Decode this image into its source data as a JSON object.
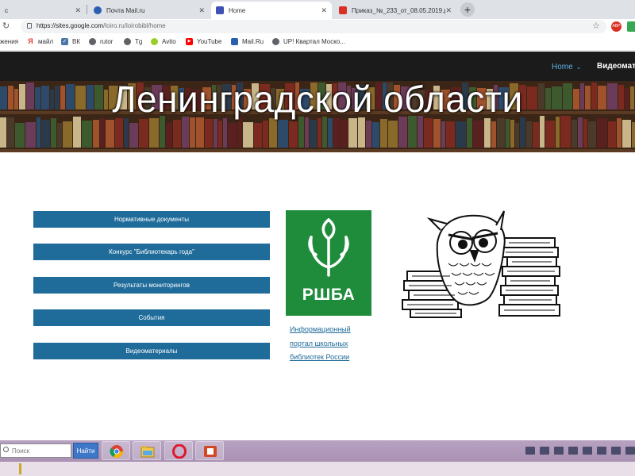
{
  "browser": {
    "tabs": [
      {
        "label": "c",
        "favicon_color": "#ffffff",
        "active": false
      },
      {
        "label": "Почта Mail.ru",
        "favicon_color": "#2a5fb0",
        "active": false
      },
      {
        "label": "Home",
        "favicon_color": "#3f51b5",
        "active": true
      },
      {
        "label": "Приказ_№_233_от_08.05.2019.p",
        "favicon_color": "#d93025",
        "active": false
      }
    ],
    "new_tab_label": "+",
    "address": {
      "host": "https://sites.google.com",
      "path": "/loiro.ru/loirobibl/home"
    },
    "bookmarks": [
      {
        "label": "жения",
        "icon": "none",
        "color": "#ffffff"
      },
      {
        "label": "майл",
        "icon": "yandex-icon",
        "glyph": "Я",
        "color": "#e53935"
      },
      {
        "label": "ВК",
        "icon": "vk-icon",
        "glyph": "В",
        "color": "#4a76a8"
      },
      {
        "label": "rutor",
        "icon": "globe-icon",
        "glyph": "",
        "color": "#5f6368"
      },
      {
        "label": "Tg",
        "icon": "globe-icon",
        "glyph": "",
        "color": "#5f6368"
      },
      {
        "label": "Avito",
        "icon": "avito-icon",
        "glyph": "",
        "color": "#97cf26"
      },
      {
        "label": "YouTube",
        "icon": "youtube-icon",
        "glyph": "▶",
        "color": "#ff0000"
      },
      {
        "label": "Mail.Ru",
        "icon": "mailru-icon",
        "glyph": "",
        "color": "#2a5fb0"
      },
      {
        "label": "UP! Квартал Моско...",
        "icon": "globe-icon",
        "glyph": "",
        "color": "#5f6368"
      }
    ]
  },
  "site": {
    "nav": {
      "home": "Home",
      "video": "Видеомат"
    },
    "banner_title": "Ленинградской области",
    "menu": [
      "Нормативные документы",
      "Конкурс \"Библиотекарь года\"",
      "Результаты мониторингов",
      "События",
      "Видеоматериалы"
    ],
    "rshba": {
      "logo_text": "РШБА",
      "logo_color": "#1f8c3b",
      "link_lines": [
        "Информационный",
        "портал школьных",
        "библиотек России"
      ]
    }
  },
  "taskbar": {
    "search_placeholder": "Поиск",
    "search_button": "Найти",
    "apps": [
      {
        "icon": "chrome-icon"
      },
      {
        "icon": "file-explorer-icon"
      },
      {
        "icon": "opera-icon"
      },
      {
        "icon": "presentation-app-icon"
      }
    ]
  },
  "colors": {
    "accent_nav": "#5fb0e6",
    "menu_button": "#1f6b9a",
    "header_bg": "#1b1b1b"
  }
}
